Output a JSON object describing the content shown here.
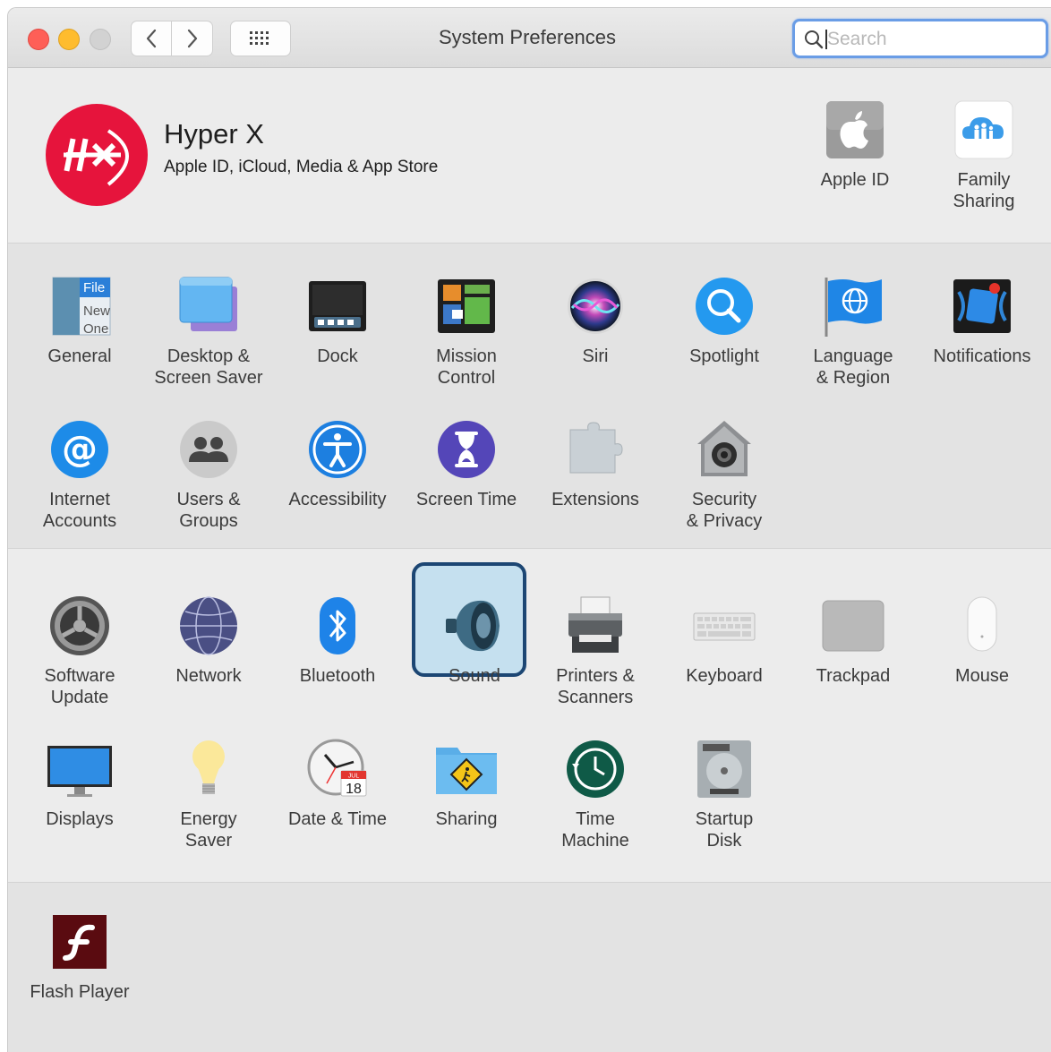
{
  "window": {
    "title": "System Preferences",
    "search_placeholder": "Search"
  },
  "account": {
    "name": "Hyper X",
    "subtitle": "Apple ID, iCloud, Media & App Store",
    "items": [
      {
        "label": "Apple ID",
        "icon": "apple-id-icon"
      },
      {
        "label": "Family\nSharing",
        "icon": "family-sharing-icon"
      }
    ]
  },
  "section1": [
    {
      "label": "General",
      "icon": "general-icon"
    },
    {
      "label": "Desktop &\nScreen Saver",
      "icon": "desktop-screen-saver-icon"
    },
    {
      "label": "Dock",
      "icon": "dock-icon"
    },
    {
      "label": "Mission\nControl",
      "icon": "mission-control-icon"
    },
    {
      "label": "Siri",
      "icon": "siri-icon"
    },
    {
      "label": "Spotlight",
      "icon": "spotlight-icon"
    },
    {
      "label": "Language\n& Region",
      "icon": "language-region-icon"
    },
    {
      "label": "Notifications",
      "icon": "notifications-icon"
    },
    {
      "label": "Internet\nAccounts",
      "icon": "internet-accounts-icon"
    },
    {
      "label": "Users &\nGroups",
      "icon": "users-groups-icon"
    },
    {
      "label": "Accessibility",
      "icon": "accessibility-icon"
    },
    {
      "label": "Screen Time",
      "icon": "screen-time-icon"
    },
    {
      "label": "Extensions",
      "icon": "extensions-icon"
    },
    {
      "label": "Security\n& Privacy",
      "icon": "security-privacy-icon"
    }
  ],
  "section2": [
    {
      "label": "Software\nUpdate",
      "icon": "software-update-icon"
    },
    {
      "label": "Network",
      "icon": "network-icon"
    },
    {
      "label": "Bluetooth",
      "icon": "bluetooth-icon"
    },
    {
      "label": "Sound",
      "icon": "sound-icon",
      "selected": true
    },
    {
      "label": "Printers &\nScanners",
      "icon": "printers-scanners-icon"
    },
    {
      "label": "Keyboard",
      "icon": "keyboard-icon"
    },
    {
      "label": "Trackpad",
      "icon": "trackpad-icon"
    },
    {
      "label": "Mouse",
      "icon": "mouse-icon"
    },
    {
      "label": "Displays",
      "icon": "displays-icon"
    },
    {
      "label": "Energy\nSaver",
      "icon": "energy-saver-icon"
    },
    {
      "label": "Date & Time",
      "icon": "date-time-icon"
    },
    {
      "label": "Sharing",
      "icon": "sharing-icon"
    },
    {
      "label": "Time\nMachine",
      "icon": "time-machine-icon"
    },
    {
      "label": "Startup\nDisk",
      "icon": "startup-disk-icon"
    }
  ],
  "section3": [
    {
      "label": "Flash Player",
      "icon": "flash-player-icon"
    }
  ],
  "icon_text": {
    "general": [
      "File",
      "New",
      "One"
    ],
    "calendar_month": "JUL",
    "calendar_day": "18"
  }
}
